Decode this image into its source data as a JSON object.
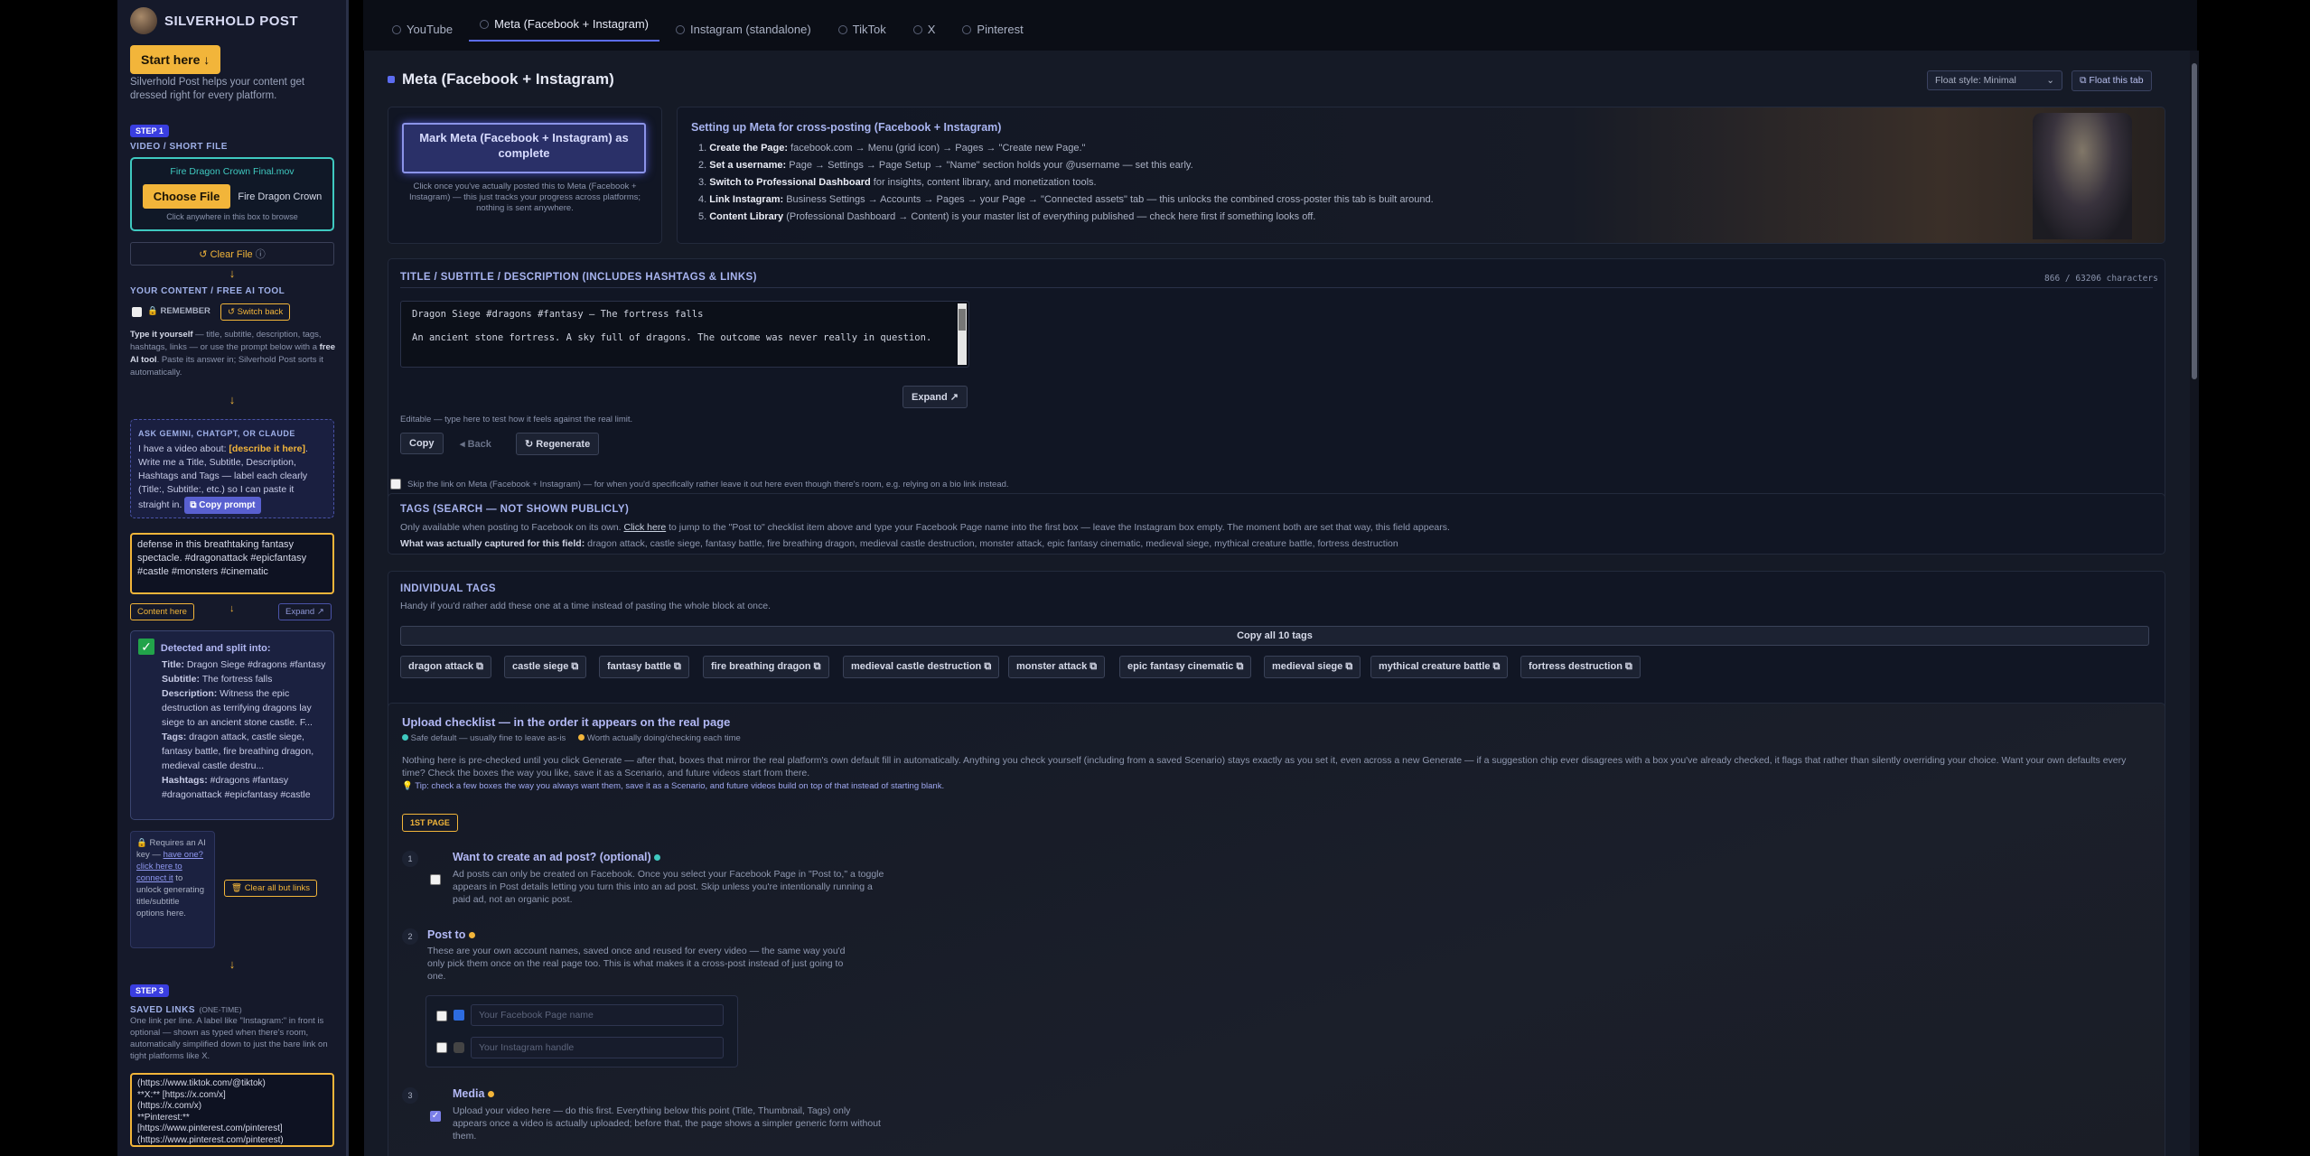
{
  "brand": {
    "name": "SILVERHOLD POST"
  },
  "sidebar": {
    "start_label": "Start here ↓",
    "intro": "Silverhold Post helps your content get dressed right for every platform.",
    "step1_badge": "STEP 1",
    "step1_title": "VIDEO / SHORT FILE",
    "file_name": "Fire Dragon Crown Final.mov",
    "choose_label": "Choose File",
    "chosen_file": "Fire Dragon Crown",
    "click_hint": "Click anywhere in this box to browse",
    "clear_file": "↺ Clear File",
    "content_title": "YOUR CONTENT / FREE AI TOOL",
    "remember_label": "🔒 REMEMBER",
    "switch_back": "↺ Switch back",
    "type_hint_1": "Type it yourself",
    "type_hint_2": " — title, subtitle, description, tags, hashtags, links — or use the prompt below with a ",
    "type_hint_3": "free AI tool",
    "type_hint_4": ". Paste its answer in; Silverhold Post sorts it automatically.",
    "ask_title": "ASK GEMINI, CHATGPT, OR CLAUDE",
    "prompt_1": "I have a video about: ",
    "prompt_hl": "[describe it here]",
    "prompt_2": ". Write me a Title, Subtitle, Description, Hashtags and Tags — label each clearly (Title:, Subtitle:, etc.) so I can paste it straight in.",
    "copy_prompt": "Copy prompt",
    "pasted_text": "defense in this breathtaking fantasy spectacle. #dragonattack #epicfantasy #castle #monsters #cinematic",
    "content_here": "Content here",
    "expand_small": "Expand ↗",
    "detected_title": "Detected and split into:",
    "det_title_k": "Title:",
    "det_title_v": " Dragon Siege #dragons #fantasy",
    "det_sub_k": "Subtitle:",
    "det_sub_v": " The fortress falls",
    "det_desc_k": "Description:",
    "det_desc_v": " Witness the epic destruction as terrifying dragons lay siege to an ancient stone castle. F...",
    "det_tags_k": "Tags:",
    "det_tags_v": " dragon attack, castle siege, fantasy battle, fire breathing dragon, medieval castle destru...",
    "det_hash_k": "Hashtags:",
    "det_hash_v": " #dragons #fantasy #dragonattack #epicfantasy #castle",
    "ai_note_1": "🔒 Requires an AI key — ",
    "ai_note_link": "have one? click here to connect it",
    "ai_note_2": " to unlock generating title/subtitle options here.",
    "clear_all": "🗑 Clear all but links",
    "step3_badge": "STEP 3",
    "saved_links_title": "SAVED LINKS",
    "saved_links_sub": "(ONE-TIME)",
    "links_hint": "One link per line. A label like \"Instagram:\" in front is optional — shown as typed when there's room, automatically simplified down to just the bare link on tight platforms like X.",
    "links_text": "(https://www.tiktok.com/@tiktok)\n**X:** [https://x.com/x]\n(https://x.com/x)\n**Pinterest:**\n[https://www.pinterest.com/pinterest]\n(https://www.pinterest.com/pinterest)"
  },
  "tabs": [
    {
      "label": "YouTube",
      "active": false
    },
    {
      "label": "Meta (Facebook + Instagram)",
      "active": true
    },
    {
      "label": "Instagram (standalone)",
      "active": false
    },
    {
      "label": "TikTok",
      "active": false
    },
    {
      "label": "X",
      "active": false
    },
    {
      "label": "Pinterest",
      "active": false
    }
  ],
  "main": {
    "page_title": "Meta (Facebook + Instagram)",
    "float_style": "Float style: Minimal",
    "float_tab": "⧉ Float this tab",
    "mark_complete": "Mark Meta (Facebook + Instagram) as complete",
    "mark_hint": "Click once you've actually posted this to Meta (Facebook + Instagram) — this just tracks your progress across platforms; nothing is sent anywhere.",
    "setup_title": "Setting up Meta for cross-posting (Facebook + Instagram)",
    "setup_steps": [
      {
        "k": "Create the Page:",
        "v": " facebook.com → Menu (grid icon) → Pages → \"Create new Page.\""
      },
      {
        "k": "Set a username:",
        "v": " Page → Settings → Page Setup → \"Name\" section holds your @username — set this early."
      },
      {
        "k": "Switch to Professional Dashboard",
        "v": " for insights, content library, and monetization tools."
      },
      {
        "k": "Link Instagram:",
        "v": " Business Settings → Accounts → Pages → your Page → \"Connected assets\" tab — this unlocks the combined cross-poster this tab is built around."
      },
      {
        "k": "Content Library",
        "v": " (Professional Dashboard → Content) is your master list of everything published — check here first if something looks off."
      }
    ],
    "tsd_title": "TITLE / SUBTITLE / DESCRIPTION (INCLUDES HASHTAGS & LINKS)",
    "char_count": "866 / 63206 characters",
    "tsd_line1": "Dragon Siege #dragons #fantasy — The fortress falls",
    "tsd_line2": "An ancient stone fortress. A sky full of dragons. The outcome was never really in question.",
    "expand": "Expand ↗",
    "editable_hint": "Editable — type here to test how it feels against the real limit.",
    "copy": "Copy",
    "back": "◂ Back",
    "regenerate": "↻ Regenerate",
    "skip_link": "Skip the link on Meta (Facebook + Instagram) — for when you'd specifically rather leave it out here even though there's room, e.g. relying on a bio link instead.",
    "tags_title": "TAGS (SEARCH — NOT SHOWN PUBLICLY)",
    "tags_hint_1": "Only available when posting to Facebook on its own. ",
    "tags_hint_link": "Click here",
    "tags_hint_2": " to jump to the \"Post to\" checklist item above and type your Facebook Page name into the first box — leave the Instagram box empty. The moment both are set that way, this field appears.",
    "captured_k": "What was actually captured for this field:",
    "captured_v": " dragon attack, castle siege, fantasy battle, fire breathing dragon, medieval castle destruction, monster attack, epic fantasy cinematic, medieval siege, mythical creature battle, fortress destruction",
    "indiv_title": "INDIVIDUAL TAGS",
    "indiv_hint": "Handy if you'd rather add these one at a time instead of pasting the whole block at once.",
    "copy_all_tags": "Copy all 10 tags",
    "tags": [
      "dragon attack ⧉",
      "castle siege ⧉",
      "fantasy battle ⧉",
      "fire breathing dragon ⧉",
      "medieval castle destruction ⧉",
      "monster attack ⧉",
      "epic fantasy cinematic ⧉",
      "medieval siege ⧉",
      "mythical creature battle ⧉",
      "fortress destruction ⧉"
    ],
    "checklist_title": "Upload checklist — in the order it appears on the real page",
    "legend_safe": "Safe default — usually fine to leave as-is",
    "legend_worth": "Worth actually doing/checking each time",
    "checklist_desc": "Nothing here is pre-checked until you click Generate — after that, boxes that mirror the real platform's own default fill in automatically. Anything you check yourself (including from a saved Scenario) stays exactly as you set it, even across a new Generate — if a suggestion chip ever disagrees with a box you've already checked, it flags that rather than silently overriding your choice. Want your own defaults every time? Check the boxes the way you like, save it as a Scenario, and future videos start from there.",
    "tip": "💡 Tip: check a few boxes the way you always want them, save it as a Scenario, and future videos build on top of that instead of starting blank.",
    "first_page": "1ST PAGE",
    "items": [
      {
        "n": "1",
        "title": "Want to create an ad post? (optional)",
        "desc": "Ad posts can only be created on Facebook. Once you select your Facebook Page in \"Post to,\" a toggle appears in Post details letting you turn this into an ad post. Skip unless you're intentionally running a paid ad, not an organic post."
      },
      {
        "n": "2",
        "title": "Post to",
        "desc": "These are your own account names, saved once and reused for every video — the same way you'd only pick them once on the real page too. This is what makes it a cross-post instead of just going to one."
      },
      {
        "n": "3",
        "title": "Media",
        "desc": "Upload your video here — do this first. Everything below this point (Title, Thumbnail, Tags) only appears once a video is actually uploaded; before that, the page shows a simpler generic form without them."
      }
    ],
    "fb_placeholder": "Your Facebook Page name",
    "ig_placeholder": "Your Instagram handle"
  }
}
